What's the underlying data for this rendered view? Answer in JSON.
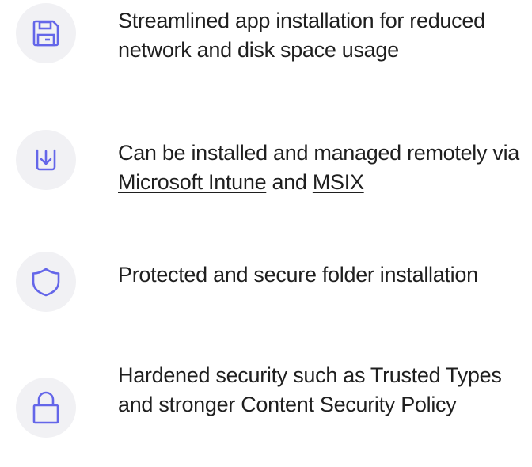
{
  "colors": {
    "icon_stroke": "#6466e9",
    "icon_background": "#f1f1f4",
    "text": "#1f1f1f"
  },
  "features": [
    {
      "icon": "floppy-disk-icon",
      "text": "Streamlined app installation for reduced network and disk space usage"
    },
    {
      "icon": "download-icon",
      "text_before": "Can be installed and managed remotely via ",
      "link_1": "Microsoft Intune",
      "text_middle": " and ",
      "link_2": "MSIX"
    },
    {
      "icon": "shield-icon",
      "text": "Protected and secure folder installation"
    },
    {
      "icon": "lock-icon",
      "text": "Hardened security such as Trusted Types and stronger Content Security Policy"
    }
  ]
}
